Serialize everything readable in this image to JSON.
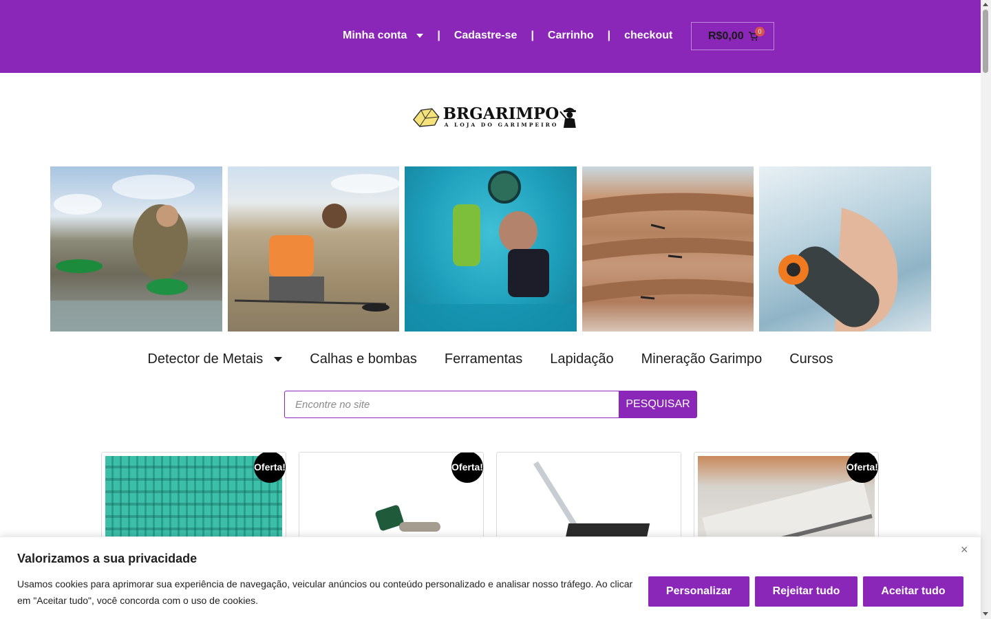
{
  "colors": {
    "brand_purple": "#8b27b8",
    "badge_red": "#d9534f",
    "sale_badge": "#000000"
  },
  "topnav": {
    "account": "Minha conta",
    "register": "Cadastre-se",
    "cart_link": "Carrinho",
    "checkout": "checkout",
    "separator": "|",
    "cart_total": "R$0,00",
    "cart_count": "0"
  },
  "logo": {
    "name": "BRGARIMPO",
    "tagline": "A LOJA DO GARIMPEIRO"
  },
  "categories": [
    {
      "label": "Detector de Metais",
      "has_dropdown": true
    },
    {
      "label": "Calhas e bombas"
    },
    {
      "label": "Ferramentas"
    },
    {
      "label": "Lapidação"
    },
    {
      "label": "Mineração Garimpo"
    },
    {
      "label": "Cursos"
    }
  ],
  "search": {
    "placeholder": "Encontre no site",
    "button": "PESQUISAR"
  },
  "products": [
    {
      "sale_badge": "Oferta!"
    },
    {
      "sale_badge": "Oferta!"
    },
    {
      "sale_badge": ""
    },
    {
      "sale_badge": "Oferta!"
    }
  ],
  "cookie": {
    "title": "Valorizamos a sua privacidade",
    "text": "Usamos cookies para aprimorar sua experiência de navegação, veicular anúncios ou conteúdo personalizado e analisar nosso tráfego. Ao clicar em \"Aceitar tudo\", você concorda com o uso de cookies.",
    "close": "×",
    "customize": "Personalizar",
    "reject": "Rejeitar tudo",
    "accept": "Aceitar tudo"
  }
}
